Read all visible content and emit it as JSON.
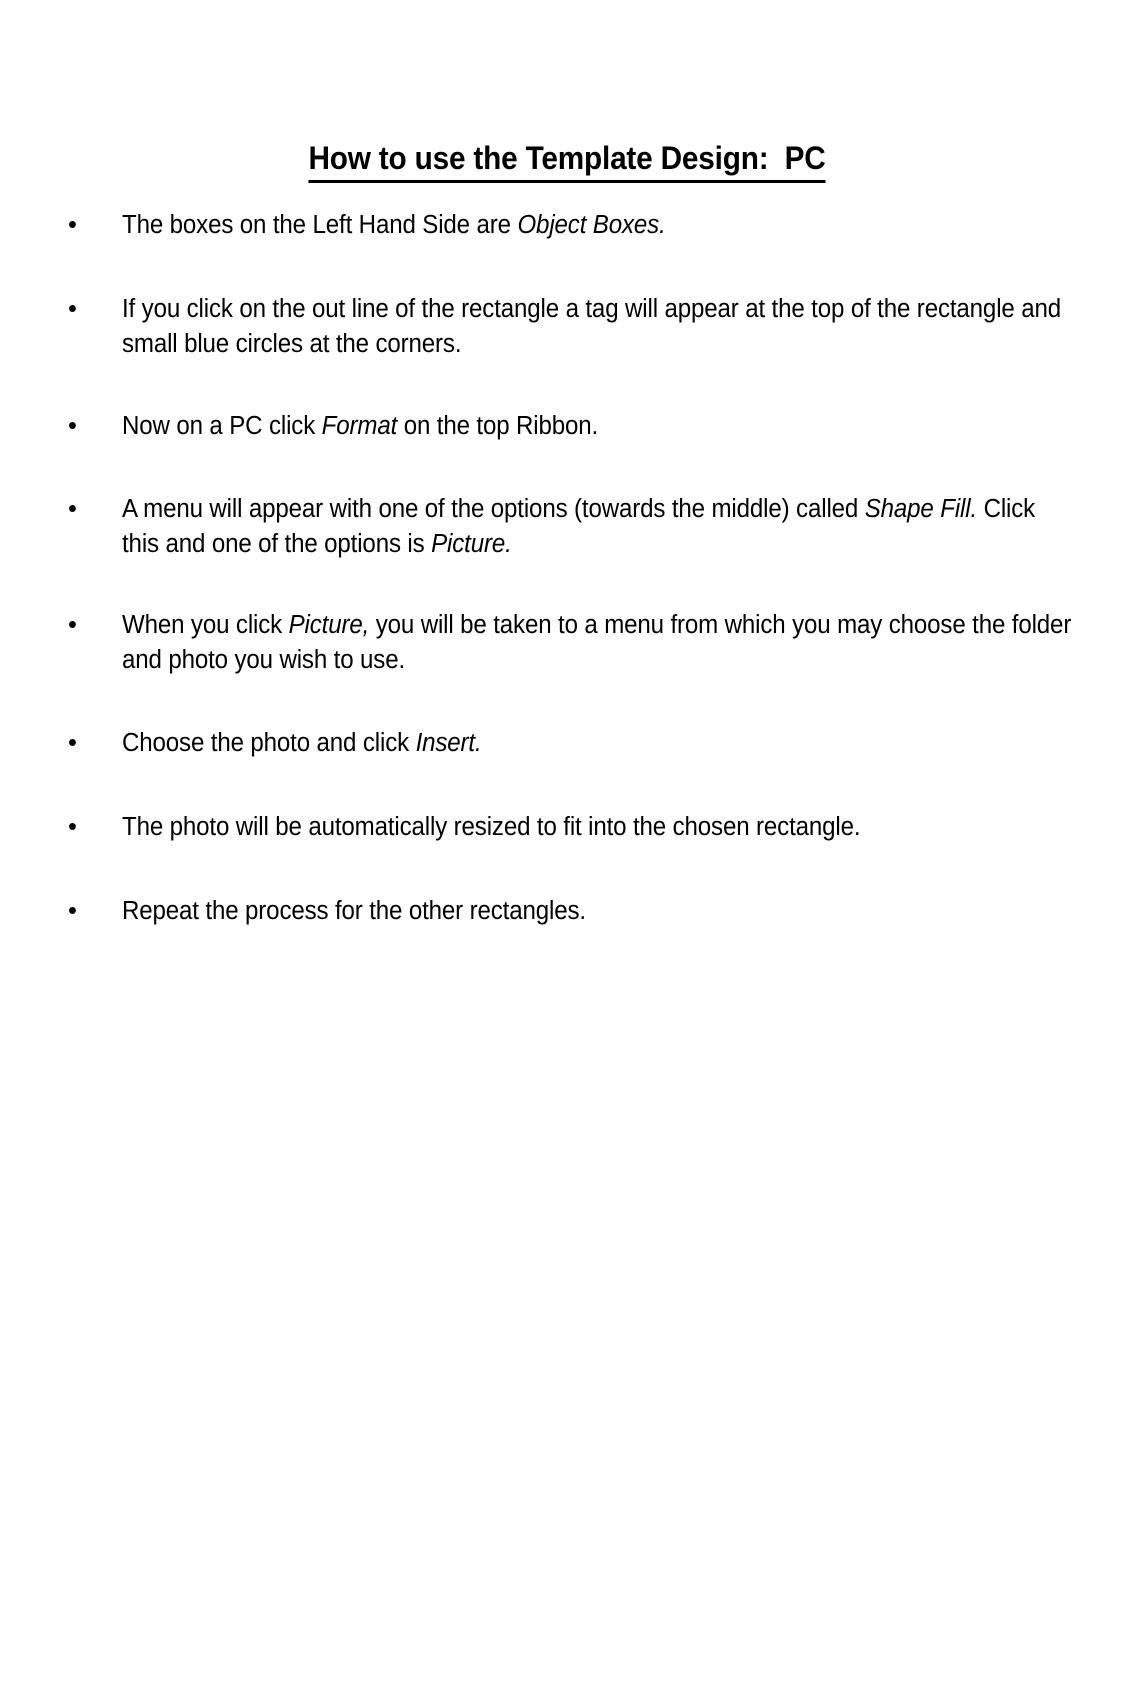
{
  "document": {
    "title_text": "How to use the Template Design:  PC",
    "page_background": "#ffffff",
    "text_color": "#000000",
    "bullet_marker": "•"
  },
  "bullets": [
    {
      "id": "bullet-object-boxes",
      "segments": [
        {
          "text": "The boxes on the Left Hand Side are ",
          "italic": false
        },
        {
          "text": "Object Boxes.",
          "italic": true
        }
      ]
    },
    {
      "id": "bullet-click-outline",
      "segments": [
        {
          "text": "If you click on the out line of the rectangle a tag will appear at the top of the rectangle and small blue circles at the corners.",
          "italic": false
        }
      ]
    },
    {
      "id": "bullet-format-ribbon",
      "segments": [
        {
          "text": "Now on a PC click ",
          "italic": false
        },
        {
          "text": "Format",
          "italic": true
        },
        {
          "text": " on the top Ribbon.",
          "italic": false
        }
      ]
    },
    {
      "id": "bullet-shape-fill",
      "segments": [
        {
          "text": "A menu will appear with one of the options (towards the middle) called ",
          "italic": false
        },
        {
          "text": "Shape Fill.",
          "italic": true
        },
        {
          "text": " Click this and one of the options is ",
          "italic": false
        },
        {
          "text": "Picture.",
          "italic": true
        }
      ]
    },
    {
      "id": "bullet-picture-menu",
      "segments": [
        {
          "text": "When you click ",
          "italic": false
        },
        {
          "text": "Picture,",
          "italic": true
        },
        {
          "text": " you will be taken to a menu from which you may choose the folder and photo you wish to use.",
          "italic": false
        }
      ]
    },
    {
      "id": "bullet-choose-insert",
      "segments": [
        {
          "text": "Choose the photo and click ",
          "italic": false
        },
        {
          "text": "Insert.",
          "italic": true
        }
      ]
    },
    {
      "id": "bullet-auto-resize",
      "segments": [
        {
          "text": "The photo will be automatically resized to fit into the chosen rectangle.",
          "italic": false
        }
      ]
    },
    {
      "id": "bullet-repeat",
      "segments": [
        {
          "text": "Repeat the process for the other rectangles.",
          "italic": false
        }
      ]
    }
  ]
}
